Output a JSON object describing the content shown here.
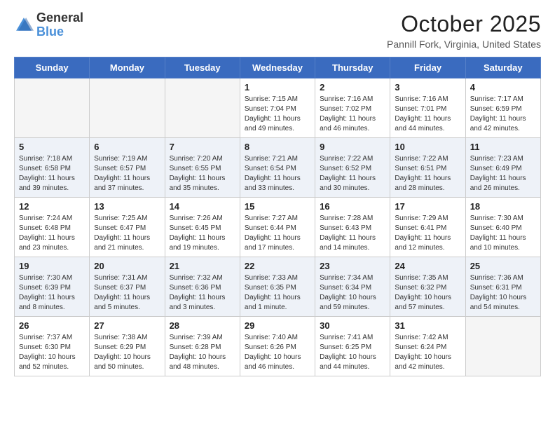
{
  "header": {
    "logo_general": "General",
    "logo_blue": "Blue",
    "month_title": "October 2025",
    "location": "Pannill Fork, Virginia, United States"
  },
  "weekdays": [
    "Sunday",
    "Monday",
    "Tuesday",
    "Wednesday",
    "Thursday",
    "Friday",
    "Saturday"
  ],
  "weeks": [
    [
      {
        "day": "",
        "info": ""
      },
      {
        "day": "",
        "info": ""
      },
      {
        "day": "",
        "info": ""
      },
      {
        "day": "1",
        "info": "Sunrise: 7:15 AM\nSunset: 7:04 PM\nDaylight: 11 hours and 49 minutes."
      },
      {
        "day": "2",
        "info": "Sunrise: 7:16 AM\nSunset: 7:02 PM\nDaylight: 11 hours and 46 minutes."
      },
      {
        "day": "3",
        "info": "Sunrise: 7:16 AM\nSunset: 7:01 PM\nDaylight: 11 hours and 44 minutes."
      },
      {
        "day": "4",
        "info": "Sunrise: 7:17 AM\nSunset: 6:59 PM\nDaylight: 11 hours and 42 minutes."
      }
    ],
    [
      {
        "day": "5",
        "info": "Sunrise: 7:18 AM\nSunset: 6:58 PM\nDaylight: 11 hours and 39 minutes."
      },
      {
        "day": "6",
        "info": "Sunrise: 7:19 AM\nSunset: 6:57 PM\nDaylight: 11 hours and 37 minutes."
      },
      {
        "day": "7",
        "info": "Sunrise: 7:20 AM\nSunset: 6:55 PM\nDaylight: 11 hours and 35 minutes."
      },
      {
        "day": "8",
        "info": "Sunrise: 7:21 AM\nSunset: 6:54 PM\nDaylight: 11 hours and 33 minutes."
      },
      {
        "day": "9",
        "info": "Sunrise: 7:22 AM\nSunset: 6:52 PM\nDaylight: 11 hours and 30 minutes."
      },
      {
        "day": "10",
        "info": "Sunrise: 7:22 AM\nSunset: 6:51 PM\nDaylight: 11 hours and 28 minutes."
      },
      {
        "day": "11",
        "info": "Sunrise: 7:23 AM\nSunset: 6:49 PM\nDaylight: 11 hours and 26 minutes."
      }
    ],
    [
      {
        "day": "12",
        "info": "Sunrise: 7:24 AM\nSunset: 6:48 PM\nDaylight: 11 hours and 23 minutes."
      },
      {
        "day": "13",
        "info": "Sunrise: 7:25 AM\nSunset: 6:47 PM\nDaylight: 11 hours and 21 minutes."
      },
      {
        "day": "14",
        "info": "Sunrise: 7:26 AM\nSunset: 6:45 PM\nDaylight: 11 hours and 19 minutes."
      },
      {
        "day": "15",
        "info": "Sunrise: 7:27 AM\nSunset: 6:44 PM\nDaylight: 11 hours and 17 minutes."
      },
      {
        "day": "16",
        "info": "Sunrise: 7:28 AM\nSunset: 6:43 PM\nDaylight: 11 hours and 14 minutes."
      },
      {
        "day": "17",
        "info": "Sunrise: 7:29 AM\nSunset: 6:41 PM\nDaylight: 11 hours and 12 minutes."
      },
      {
        "day": "18",
        "info": "Sunrise: 7:30 AM\nSunset: 6:40 PM\nDaylight: 11 hours and 10 minutes."
      }
    ],
    [
      {
        "day": "19",
        "info": "Sunrise: 7:30 AM\nSunset: 6:39 PM\nDaylight: 11 hours and 8 minutes."
      },
      {
        "day": "20",
        "info": "Sunrise: 7:31 AM\nSunset: 6:37 PM\nDaylight: 11 hours and 5 minutes."
      },
      {
        "day": "21",
        "info": "Sunrise: 7:32 AM\nSunset: 6:36 PM\nDaylight: 11 hours and 3 minutes."
      },
      {
        "day": "22",
        "info": "Sunrise: 7:33 AM\nSunset: 6:35 PM\nDaylight: 11 hours and 1 minute."
      },
      {
        "day": "23",
        "info": "Sunrise: 7:34 AM\nSunset: 6:34 PM\nDaylight: 10 hours and 59 minutes."
      },
      {
        "day": "24",
        "info": "Sunrise: 7:35 AM\nSunset: 6:32 PM\nDaylight: 10 hours and 57 minutes."
      },
      {
        "day": "25",
        "info": "Sunrise: 7:36 AM\nSunset: 6:31 PM\nDaylight: 10 hours and 54 minutes."
      }
    ],
    [
      {
        "day": "26",
        "info": "Sunrise: 7:37 AM\nSunset: 6:30 PM\nDaylight: 10 hours and 52 minutes."
      },
      {
        "day": "27",
        "info": "Sunrise: 7:38 AM\nSunset: 6:29 PM\nDaylight: 10 hours and 50 minutes."
      },
      {
        "day": "28",
        "info": "Sunrise: 7:39 AM\nSunset: 6:28 PM\nDaylight: 10 hours and 48 minutes."
      },
      {
        "day": "29",
        "info": "Sunrise: 7:40 AM\nSunset: 6:26 PM\nDaylight: 10 hours and 46 minutes."
      },
      {
        "day": "30",
        "info": "Sunrise: 7:41 AM\nSunset: 6:25 PM\nDaylight: 10 hours and 44 minutes."
      },
      {
        "day": "31",
        "info": "Sunrise: 7:42 AM\nSunset: 6:24 PM\nDaylight: 10 hours and 42 minutes."
      },
      {
        "day": "",
        "info": ""
      }
    ]
  ]
}
